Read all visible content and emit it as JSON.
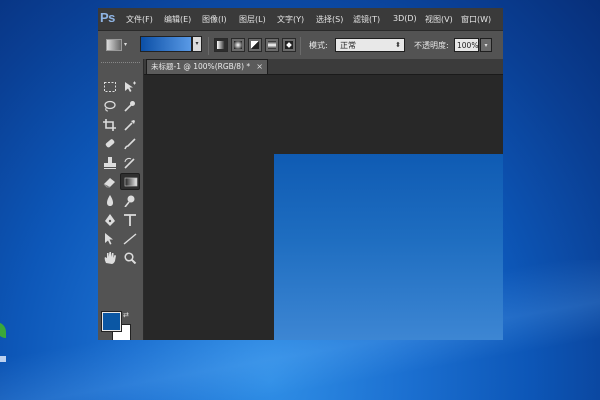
{
  "app": {
    "logo": "Ps",
    "menus": [
      "文件(F)",
      "编辑(E)",
      "图像(I)",
      "图层(L)",
      "文字(Y)",
      "选择(S)",
      "滤镜(T)",
      "3D(D)",
      "视图(V)",
      "窗口(W)"
    ]
  },
  "options": {
    "mode_label": "模式:",
    "mode_value": "正常",
    "opacity_label": "不透明度:",
    "opacity_value": "100%",
    "gradient_colors": [
      "#0b4fa6",
      "#5a9ae6"
    ]
  },
  "tools": [
    "rectangular-marquee",
    "move",
    "lasso",
    "quick-selection",
    "crop",
    "eyedropper",
    "healing-brush",
    "brush",
    "clone-stamp",
    "history-brush",
    "eraser",
    "gradient",
    "blur",
    "dodge",
    "pen",
    "type",
    "path-selection",
    "line",
    "hand",
    "zoom"
  ],
  "active_tool": "gradient",
  "colors": {
    "foreground": "#0b57a4",
    "background": "#ffffff"
  },
  "document": {
    "tab_title": "未标题-1 @ 100%(RGB/8) *",
    "close_glyph": "×"
  }
}
